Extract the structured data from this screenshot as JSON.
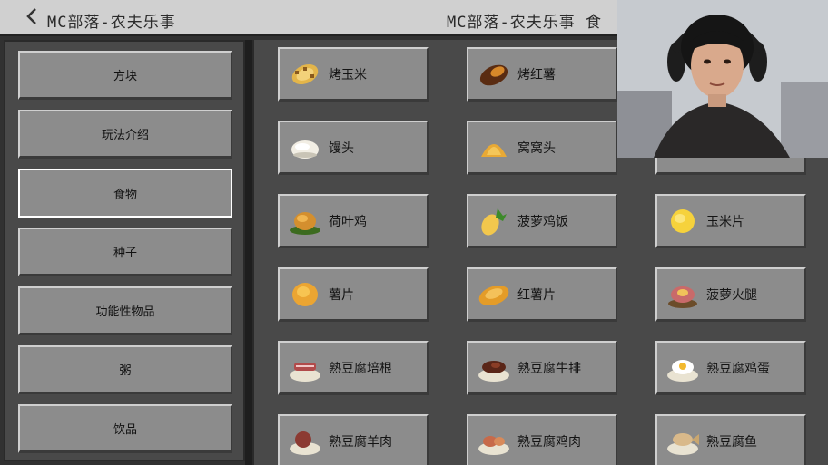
{
  "header": {
    "back_icon": "chevron-left-icon",
    "title_left": "MC部落-农夫乐事",
    "title_right": "MC部落-农夫乐事 食"
  },
  "sidebar": {
    "items": [
      {
        "label": "方块"
      },
      {
        "label": "玩法介绍"
      },
      {
        "label": "食物",
        "selected": true
      },
      {
        "label": "种子"
      },
      {
        "label": "功能性物品"
      },
      {
        "label": "粥"
      },
      {
        "label": "饮品"
      }
    ]
  },
  "grid": {
    "items": [
      {
        "label": "烤玉米",
        "icon": "roasted-corn-icon"
      },
      {
        "label": "烤红薯",
        "icon": "roasted-sweet-potato-icon"
      },
      {
        "label": "",
        "icon": "food-icon"
      },
      {
        "label": "馒头",
        "icon": "steamed-bun-icon"
      },
      {
        "label": "窝窝头",
        "icon": "corn-bun-icon"
      },
      {
        "label": "",
        "icon": "food-icon"
      },
      {
        "label": "荷叶鸡",
        "icon": "lotus-chicken-icon"
      },
      {
        "label": "菠萝鸡饭",
        "icon": "pineapple-chicken-rice-icon"
      },
      {
        "label": "玉米片",
        "icon": "corn-chips-icon"
      },
      {
        "label": "薯片",
        "icon": "potato-chips-icon"
      },
      {
        "label": "红薯片",
        "icon": "sweet-potato-chips-icon"
      },
      {
        "label": "菠萝火腿",
        "icon": "pineapple-ham-icon"
      },
      {
        "label": "熟豆腐培根",
        "icon": "tofu-bacon-icon"
      },
      {
        "label": "熟豆腐牛排",
        "icon": "tofu-steak-icon"
      },
      {
        "label": "熟豆腐鸡蛋",
        "icon": "tofu-egg-icon"
      },
      {
        "label": "熟豆腐羊肉",
        "icon": "tofu-mutton-icon"
      },
      {
        "label": "熟豆腐鸡肉",
        "icon": "tofu-chicken-icon"
      },
      {
        "label": "熟豆腐鱼",
        "icon": "tofu-fish-icon"
      }
    ]
  },
  "colors": {
    "button_face": "#8c8c8c",
    "panel_bg": "#494949",
    "title_bar": "#d0d0d0"
  }
}
